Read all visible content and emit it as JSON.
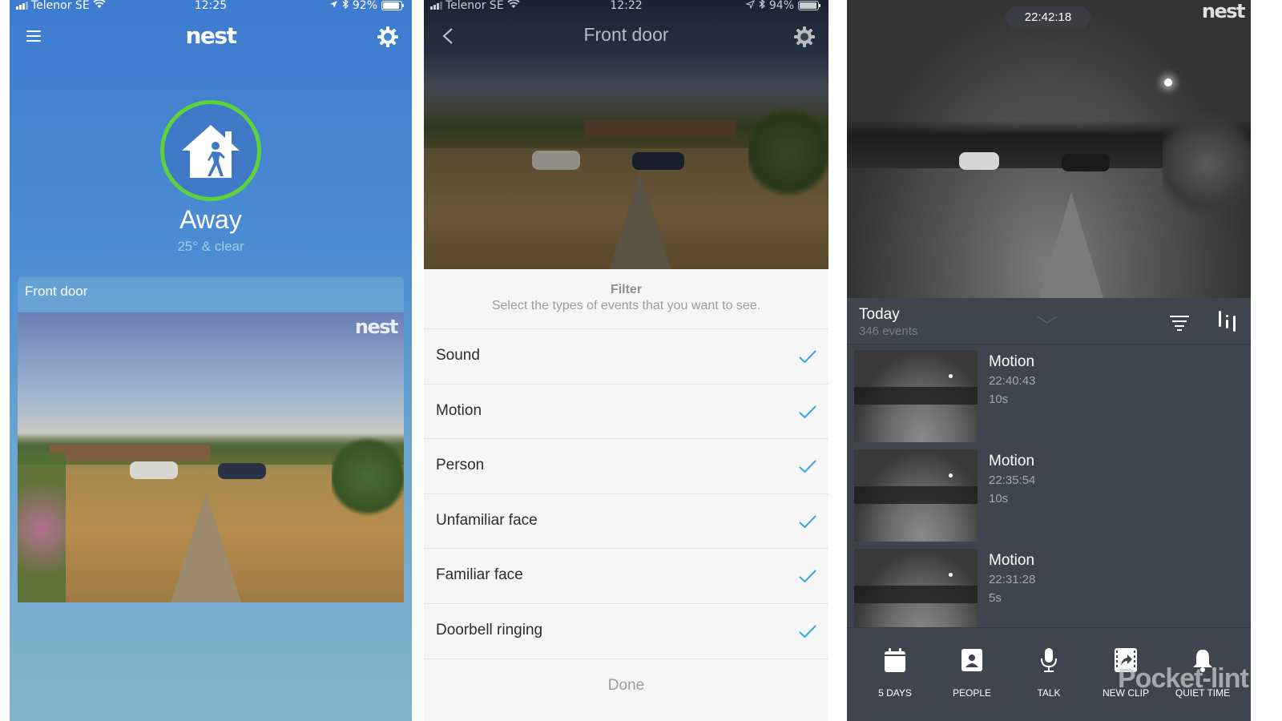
{
  "left": {
    "status": {
      "carrier": "Telenor SE",
      "time": "12:25",
      "battery": "92%",
      "battery_level": 0.92
    },
    "header": {
      "logo": "nest"
    },
    "home": {
      "mode": "Away",
      "weather": "25° & clear",
      "ring_color": "#5ed23a"
    },
    "camera_card": {
      "title": "Front door",
      "watermark": "nest"
    }
  },
  "middle": {
    "status": {
      "carrier": "Telenor SE",
      "time": "12:22",
      "battery": "94%",
      "battery_level": 0.94
    },
    "header": {
      "title": "Front door"
    },
    "filter": {
      "title": "Filter",
      "subtitle": "Select the types of events that you want to see.",
      "options": [
        {
          "label": "Sound",
          "checked": true
        },
        {
          "label": "Motion",
          "checked": true
        },
        {
          "label": "Person",
          "checked": true
        },
        {
          "label": "Unfamiliar face",
          "checked": true
        },
        {
          "label": "Familiar face",
          "checked": true
        },
        {
          "label": "Doorbell ringing",
          "checked": true
        }
      ],
      "done_label": "Done",
      "check_color": "#2fa7e0"
    }
  },
  "right": {
    "live": {
      "timestamp": "22:42:18",
      "watermark": "nest"
    },
    "events_header": {
      "title": "Today",
      "count": "346 events"
    },
    "events": [
      {
        "type": "Motion",
        "time": "22:40:43",
        "duration": "10s"
      },
      {
        "type": "Motion",
        "time": "22:35:54",
        "duration": "10s"
      },
      {
        "type": "Motion",
        "time": "22:31:28",
        "duration": "5s"
      }
    ],
    "toolbar": [
      {
        "label": "5 DAYS",
        "icon": "calendar-icon"
      },
      {
        "label": "PEOPLE",
        "icon": "person-icon"
      },
      {
        "label": "TALK",
        "icon": "microphone-icon"
      },
      {
        "label": "NEW CLIP",
        "icon": "clip-share-icon"
      },
      {
        "label": "QUIET TIME",
        "icon": "bell-icon"
      }
    ],
    "watermark": "Pocket-lint"
  }
}
